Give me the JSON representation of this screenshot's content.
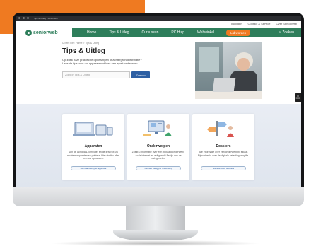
{
  "browser": {
    "tab_text": "Tips & Uitleg | Seniorweb"
  },
  "toplinks": [
    "Inloggen",
    "Contact & Service",
    "Over SeniorWeb"
  ],
  "nav": {
    "logo": "seniorweb",
    "items": [
      "Home",
      "Tips & Uitleg",
      "Cursussen",
      "PC Hulp",
      "Webwinkel"
    ],
    "cta": "Lid worden",
    "search": "Zoeken"
  },
  "hero": {
    "breadcrumb": "U bent hier: Home > Tips & Uitleg",
    "title": "Tips & Uitleg",
    "intro": "Op zoek naar praktische oplossingen of achtergrondinformatie? Lees de tips voor uw apparaten of kies een apart onderwerp.",
    "search_placeholder": "Zoek in Tips & Uitleg",
    "search_button": "Zoeken"
  },
  "cards": [
    {
      "title": "Apparaten",
      "desc": "Van de Windows-computer en de iPad tot uw mobiele apparaten en printers. Hier vindt u alles over uw apparaten.",
      "button": "Ga naar uitleg per apparaat"
    },
    {
      "title": "Onderwerpen",
      "desc": "Zoekt u informatie over een bepaald onderwerp, zoals internet en veiligheid? Bekijk dan de categorieën.",
      "button": "Ga naar uitleg per onderwerp"
    },
    {
      "title": "Dossiers",
      "desc": "Alle informatie over een onderwerp bij elkaar. Bijvoorbeeld over de digitale belastingaangifte.",
      "button": "Ga naar onze dossiers"
    }
  ],
  "colors": {
    "brand_green": "#2e7e5b",
    "accent_orange": "#ef7a21",
    "link_blue": "#2d5fa3"
  }
}
